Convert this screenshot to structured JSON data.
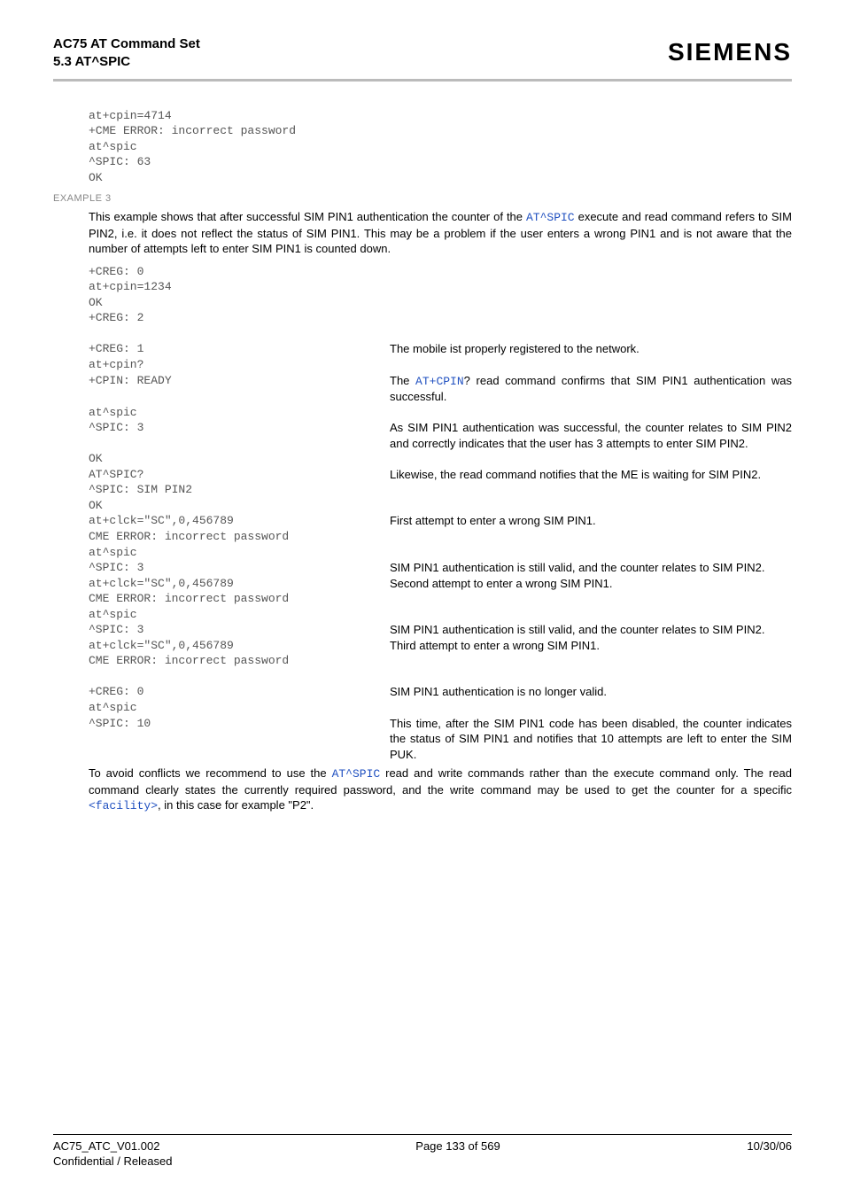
{
  "header": {
    "title": "AC75 AT Command Set",
    "section": "5.3 AT^SPIC",
    "brand": "SIEMENS"
  },
  "block1": {
    "l1": "at+cpin=4714",
    "l2": "+CME ERROR: incorrect password",
    "l3": "at^spic",
    "l4": "^SPIC: 63",
    "l5": "OK"
  },
  "example3_label": "EXAMPLE 3",
  "example3_intro_a": "This example shows that after successful SIM PIN1 authentication the counter of the ",
  "example3_intro_link": "AT^SPIC",
  "example3_intro_b": " execute and read command refers to SIM PIN2, i.e. it does not reflect the status of SIM PIN1. This may be a problem if the user enters a wrong PIN1 and is not aware that the number of attempts left to enter SIM PIN1 is counted down.",
  "rows": {
    "r1": {
      "l": "+CREG: 0",
      "r": ""
    },
    "r2": {
      "l": "at+cpin=1234",
      "r": ""
    },
    "r3": {
      "l": "OK",
      "r": ""
    },
    "r4": {
      "l": "+CREG: 2",
      "r": ""
    },
    "r5": {
      "l": "",
      "r": ""
    },
    "r6": {
      "l": "+CREG: 1",
      "r": "The mobile ist properly registered to the network."
    },
    "r7": {
      "l": "at+cpin?",
      "r": ""
    },
    "r8": {
      "l": "+CPIN: READY",
      "r_pre": "The ",
      "r_link": "AT+CPIN",
      "r_post": "? read command confirms that SIM PIN1 authentication was successful."
    },
    "r9": {
      "l": "at^spic",
      "r": ""
    },
    "r10": {
      "l": "^SPIC: 3",
      "r": "As SIM PIN1 authentication was successful, the counter relates to SIM PIN2 and correctly indicates that the user has 3 attempts to enter SIM PIN2."
    },
    "r11": {
      "l": "OK",
      "r": ""
    },
    "r12": {
      "l": "AT^SPIC?",
      "r": "Likewise, the read command notifies that the ME is waiting for SIM PIN2."
    },
    "r13": {
      "l": "^SPIC: SIM PIN2",
      "r": ""
    },
    "r14": {
      "l": "OK",
      "r": ""
    },
    "r15": {
      "l": "at+clck=\"SC\",0,456789",
      "r": "First attempt to enter a wrong SIM PIN1."
    },
    "r16": {
      "l": "CME ERROR: incorrect password",
      "r": ""
    },
    "r17": {
      "l": "at^spic",
      "r": ""
    },
    "r18": {
      "l": "^SPIC: 3",
      "r": "SIM PIN1 authentication is still valid, and the counter relates to SIM PIN2."
    },
    "r19": {
      "l": "at+clck=\"SC\",0,456789",
      "r": "Second attempt to enter a wrong SIM PIN1."
    },
    "r20": {
      "l": "CME ERROR: incorrect password",
      "r": ""
    },
    "r21": {
      "l": "at^spic",
      "r": ""
    },
    "r22": {
      "l": "^SPIC: 3",
      "r": "SIM PIN1 authentication is still valid, and the counter relates to SIM PIN2."
    },
    "r23": {
      "l": "at+clck=\"SC\",0,456789",
      "r": "Third attempt to enter a wrong SIM PIN1."
    },
    "r24": {
      "l": "CME ERROR: incorrect password",
      "r": ""
    },
    "r25": {
      "l": "",
      "r": ""
    },
    "r26": {
      "l": "+CREG: 0",
      "r": "SIM PIN1 authentication is no longer valid."
    },
    "r27": {
      "l": "at^spic",
      "r": ""
    },
    "r28": {
      "l": "^SPIC: 10",
      "r": "This time, after the SIM PIN1 code has been disabled, the counter indicates the status of SIM PIN1 and notifies that 10 attempts are left to enter the SIM PUK."
    }
  },
  "closing": {
    "a": "To avoid conflicts we recommend to use the ",
    "link1": "AT^SPIC",
    "b": " read and write commands rather than the execute command only. The read command clearly states the currently required password, and the write command may be used to get the counter for a specific ",
    "link2": "<facility>",
    "c": ", in this case for example \"P2\"."
  },
  "footer": {
    "doc": "AC75_ATC_V01.002",
    "conf": "Confidential / Released",
    "page": "Page 133 of 569",
    "date": "10/30/06"
  }
}
